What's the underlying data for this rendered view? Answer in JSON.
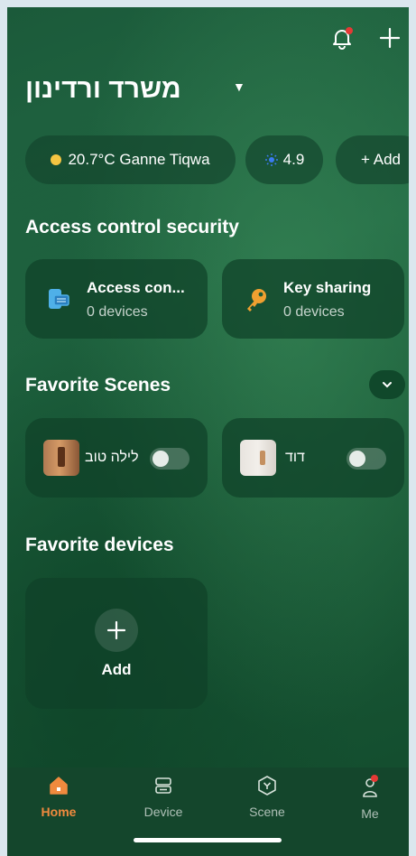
{
  "header": {
    "notification_icon": "bell-icon",
    "notification_badge_color": "#e53935",
    "add_icon": "plus-icon",
    "home_name": "משרד ורדינון"
  },
  "chips": {
    "weather": "20.7°C Ganne Tiqwa",
    "air_quality": "4.9",
    "add": "+ Add"
  },
  "access": {
    "title": "Access control security",
    "cards": [
      {
        "title": "Access con...",
        "sub": "0 devices",
        "icon": "access-card-icon"
      },
      {
        "title": "Key sharing",
        "sub": "0 devices",
        "icon": "key-icon"
      }
    ]
  },
  "scenes": {
    "title": "Favorite Scenes",
    "items": [
      {
        "label": "לילה טוב",
        "enabled": false
      },
      {
        "label": "דוד",
        "enabled": false
      }
    ]
  },
  "devices": {
    "title": "Favorite devices",
    "add_label": "Add"
  },
  "tabs": [
    {
      "label": "Home",
      "icon": "home-icon",
      "active": true
    },
    {
      "label": "Device",
      "icon": "device-icon",
      "active": false
    },
    {
      "label": "Scene",
      "icon": "scene-icon",
      "active": false
    },
    {
      "label": "Me",
      "icon": "user-icon",
      "active": false
    }
  ],
  "colors": {
    "accent": "#f08a3e",
    "key_icon": "#f0a030",
    "access_icon": "#4fb0e8"
  }
}
